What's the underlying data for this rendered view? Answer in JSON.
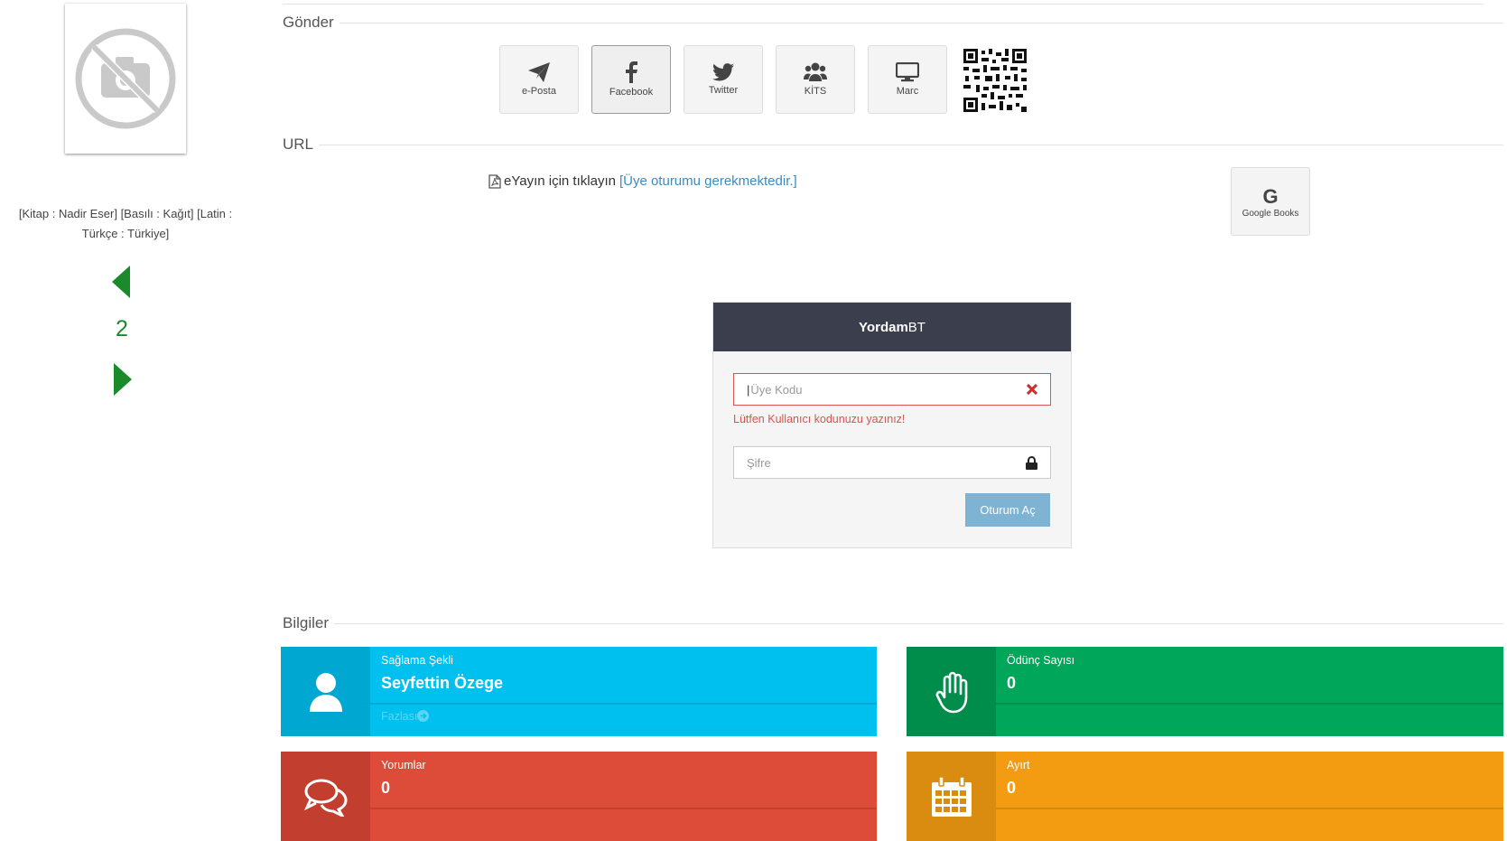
{
  "record": {
    "meta_text": "[Kitap : Nadir Eser] [Basılı : Kağıt] [Latin : Türkçe : Türkiye]",
    "page_number": "2"
  },
  "share": {
    "legend": "Gönder",
    "buttons": [
      {
        "label": "e-Posta",
        "icon": "paper-plane-icon"
      },
      {
        "label": "Facebook",
        "icon": "facebook-icon"
      },
      {
        "label": "Twitter",
        "icon": "twitter-icon"
      },
      {
        "label": "KİTS",
        "icon": "users-icon"
      },
      {
        "label": "Marc",
        "icon": "monitor-icon"
      }
    ]
  },
  "url": {
    "legend": "URL",
    "text": "eYayın için tıklayın",
    "link": "[Üye oturumu gerekmektedir.]",
    "google_books": "Google Books",
    "google_glyph": "G"
  },
  "login": {
    "brand_bold": "Yordam",
    "brand_rest": "BT",
    "user_placeholder": "Üye Kodu",
    "error": "Lütfen Kullanıcı kodunuzu yazınız!",
    "password_placeholder": "Şifre",
    "submit": "Oturum Aç"
  },
  "info": {
    "legend": "Bilgiler",
    "boxes": [
      {
        "title": "Sağlama Şekli",
        "value": "Seyfettin Özege",
        "more": "Fazlası",
        "color": "#00c0ef",
        "icon_bg": "#00a7d0"
      },
      {
        "title": "Ödünç Sayısı",
        "value": "0",
        "color": "#00a65a",
        "icon_bg": "#008d4c"
      },
      {
        "title": "Yorumlar",
        "value": "0",
        "color": "#dd4b39",
        "icon_bg": "#c23f2f"
      },
      {
        "title": "Ayırt",
        "value": "0",
        "color": "#f39c12",
        "icon_bg": "#da8c10"
      }
    ]
  }
}
